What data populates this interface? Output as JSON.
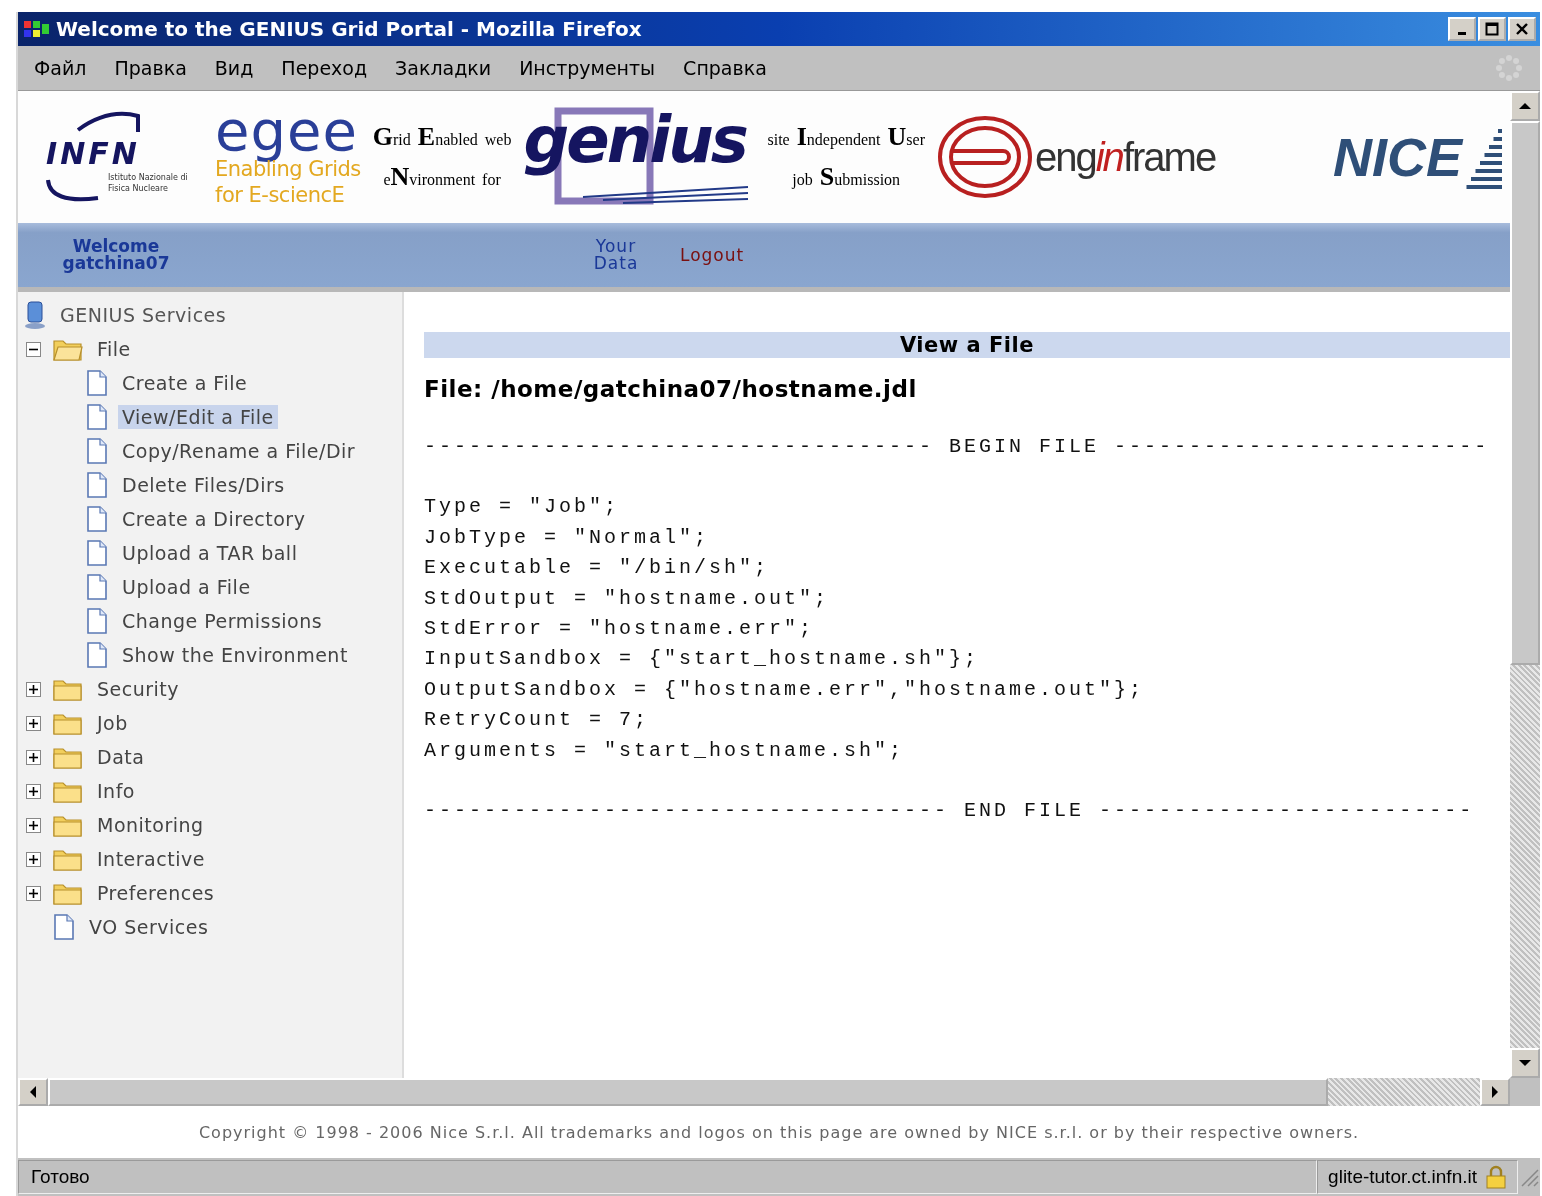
{
  "window": {
    "title": "Welcome to the GENIUS Grid Portal - Mozilla Firefox"
  },
  "menu_bar": [
    "Файл",
    "Правка",
    "Вид",
    "Переход",
    "Закладки",
    "Инструменты",
    "Справка"
  ],
  "banner": {
    "infn": {
      "name": "INFN",
      "subtitle": "Istituto Nazionale di Fisica Nucleare"
    },
    "egee": {
      "name": "egee",
      "line1": "Enabling Grids",
      "line2": "for E-sciencE"
    },
    "genius_acronym_1": [
      "**G**rid **E**nabled web",
      "e**N**vironment for"
    ],
    "genius": "genius",
    "genius_acronym_2": [
      "site **I**ndependent **U**ser",
      "job **S**ubmission"
    ],
    "enginframe": {
      "part1": "eng",
      "part2": "in",
      "part3": "frame"
    },
    "nice": "NICE"
  },
  "nav": {
    "greeting": "Welcome",
    "username": "gatchina07",
    "links": [
      {
        "label": "Your Data",
        "kind": "data"
      },
      {
        "label": "Logout",
        "kind": "logout"
      }
    ]
  },
  "sidebar": {
    "title": "GENIUS Services",
    "items": [
      {
        "label": "File",
        "kind": "folder",
        "expanded": true,
        "selected": false,
        "children": [
          {
            "label": "Create a File",
            "kind": "page",
            "selected": false
          },
          {
            "label": "View/Edit a File",
            "kind": "page",
            "selected": true
          },
          {
            "label": "Copy/Rename a File/Dir",
            "kind": "page",
            "selected": false
          },
          {
            "label": "Delete Files/Dirs",
            "kind": "page",
            "selected": false
          },
          {
            "label": "Create a Directory",
            "kind": "page",
            "selected": false
          },
          {
            "label": "Upload a TAR ball",
            "kind": "page",
            "selected": false
          },
          {
            "label": "Upload a File",
            "kind": "page",
            "selected": false
          },
          {
            "label": "Change Permissions",
            "kind": "page",
            "selected": false
          },
          {
            "label": "Show the Environment",
            "kind": "page",
            "selected": false
          }
        ]
      },
      {
        "label": "Security",
        "kind": "folder",
        "expanded": false,
        "selected": false
      },
      {
        "label": "Job",
        "kind": "folder",
        "expanded": false,
        "selected": false
      },
      {
        "label": "Data",
        "kind": "folder",
        "expanded": false,
        "selected": false
      },
      {
        "label": "Info",
        "kind": "folder",
        "expanded": false,
        "selected": false
      },
      {
        "label": "Monitoring",
        "kind": "folder",
        "expanded": false,
        "selected": false
      },
      {
        "label": "Interactive",
        "kind": "folder",
        "expanded": false,
        "selected": false
      },
      {
        "label": "Preferences",
        "kind": "folder",
        "expanded": false,
        "selected": false
      },
      {
        "label": "VO Services",
        "kind": "page",
        "selected": false
      }
    ]
  },
  "main": {
    "heading": "View a File",
    "file_path": "File: /home/gatchina07/hostname.jdl",
    "begin_marker": "---------------------------------- BEGIN FILE -------------------------",
    "lines": [
      "Type = \"Job\";",
      "JobType = \"Normal\";",
      "Executable = \"/bin/sh\";",
      "StdOutput = \"hostname.out\";",
      "StdError = \"hostname.err\";",
      "InputSandbox = {\"start_hostname.sh\"};",
      "OutputSandbox = {\"hostname.err\",\"hostname.out\"};",
      "RetryCount = 7;",
      "Arguments = \"start_hostname.sh\";"
    ],
    "end_marker": "----------------------------------- END FILE -------------------------"
  },
  "footer": "Copyright © 1998 - 2006 Nice S.r.l. All trademarks and logos on this page are owned by NICE s.r.l. or by their respective owners.",
  "status_bar": {
    "message": "Готово",
    "host": "glite-tutor.ct.infn.it"
  }
}
